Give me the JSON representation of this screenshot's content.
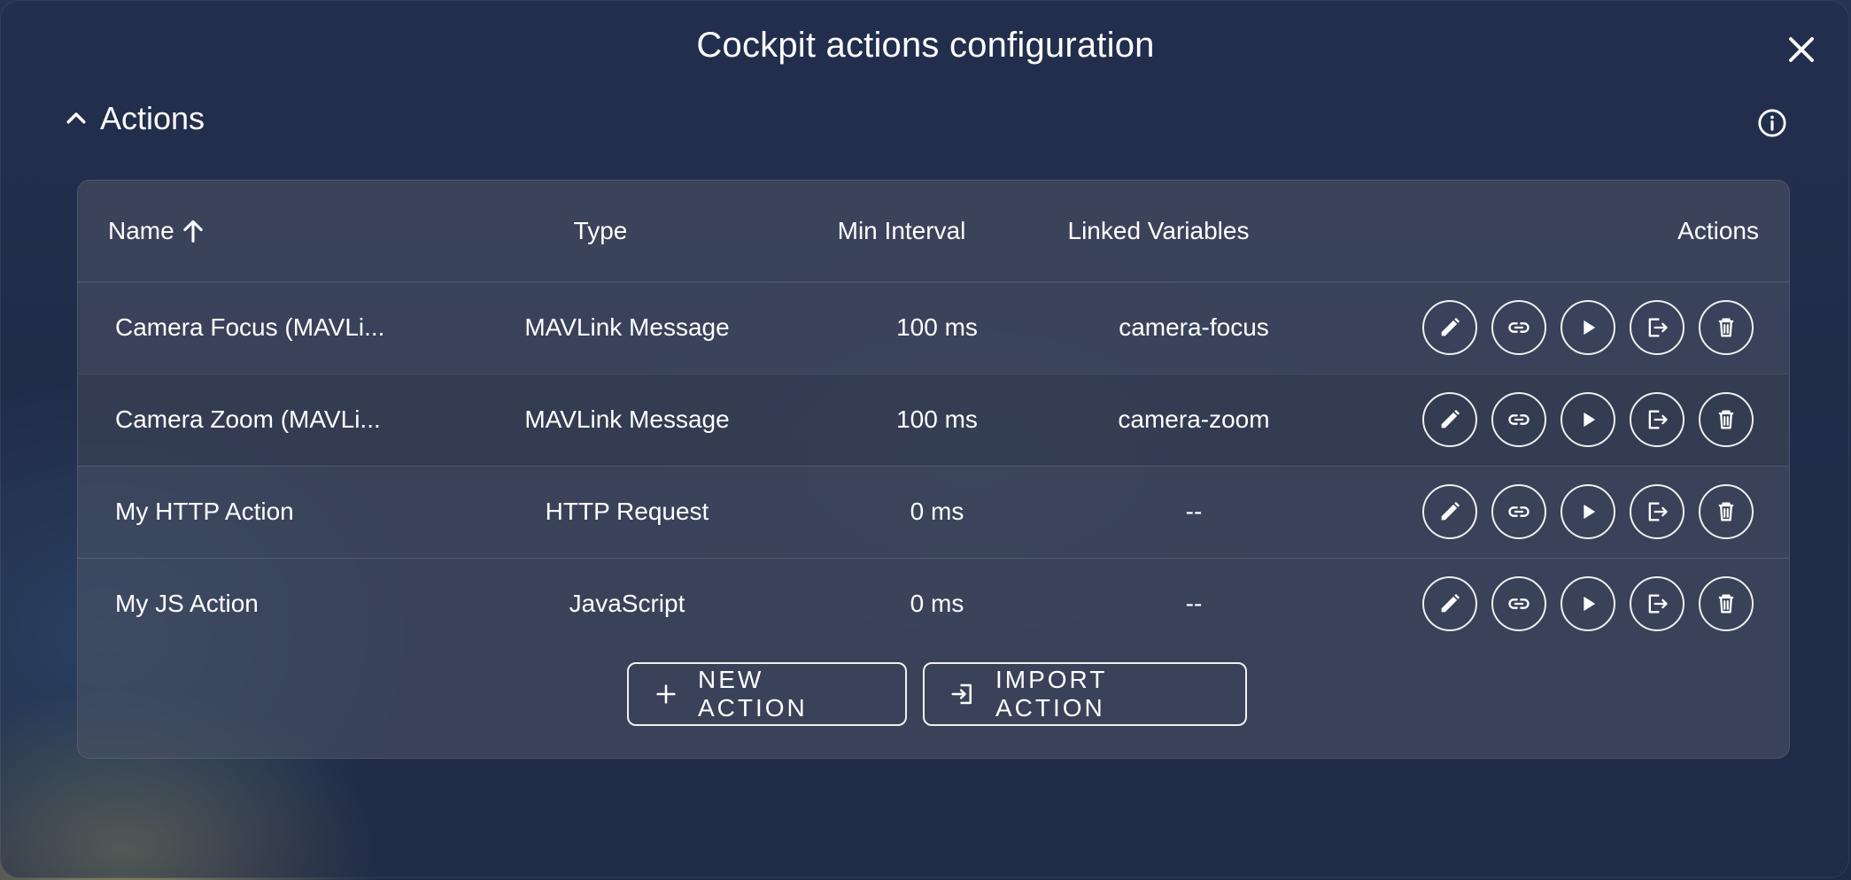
{
  "dialog": {
    "title": "Cockpit actions configuration",
    "close_icon": "close-icon",
    "info_icon": "info-icon"
  },
  "section": {
    "title": "Actions",
    "expanded": true,
    "toggle_icon": "chevron-up-icon"
  },
  "table": {
    "headers": {
      "name": "Name",
      "type": "Type",
      "interval": "Min Interval",
      "linked": "Linked Variables",
      "actions": "Actions"
    },
    "sort_icon": "arrow-up-icon",
    "rows": [
      {
        "name": "Camera Focus (MAVLi...",
        "type": "MAVLink Message",
        "interval": "100 ms",
        "linked": "camera-focus"
      },
      {
        "name": "Camera Zoom (MAVLi...",
        "type": "MAVLink Message",
        "interval": "100 ms",
        "linked": "camera-zoom"
      },
      {
        "name": "My HTTP Action",
        "type": "HTTP Request",
        "interval": "0 ms",
        "linked": "--"
      },
      {
        "name": "My JS Action",
        "type": "JavaScript",
        "interval": "0 ms",
        "linked": "--"
      }
    ],
    "row_action_icons": [
      "pencil-icon",
      "link-icon",
      "play-icon",
      "export-icon",
      "trash-icon"
    ]
  },
  "footer": {
    "new_action_label": "NEW ACTION",
    "import_action_label": "IMPORT ACTION",
    "new_icon": "plus-icon",
    "import_icon": "import-icon"
  },
  "colors": {
    "background": "#1f2a44",
    "card": "#474f62",
    "text": "#ffffff"
  }
}
